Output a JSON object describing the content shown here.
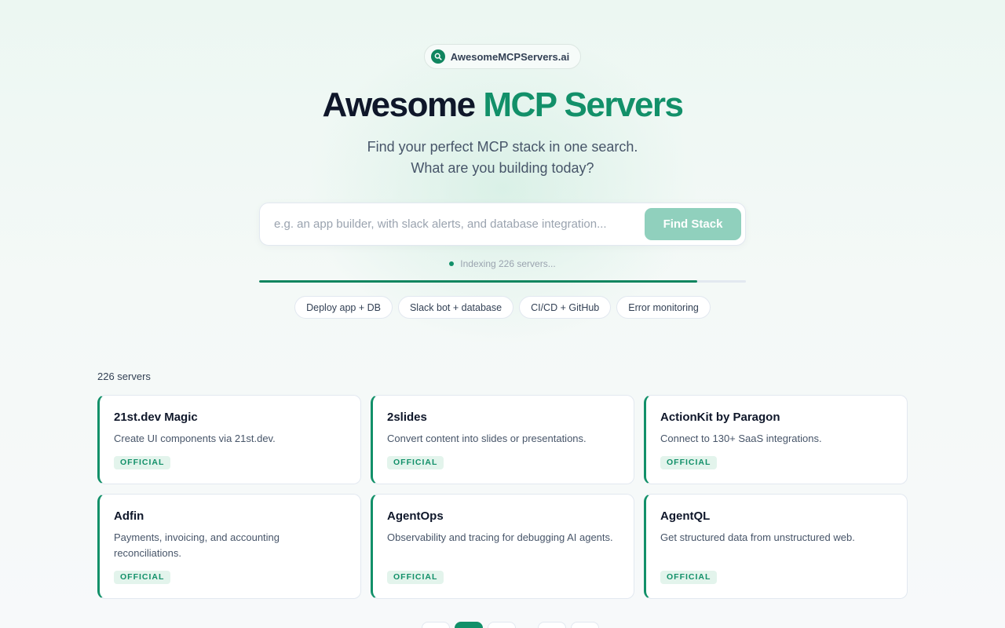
{
  "brand": {
    "label": "AwesomeMCPServers.ai"
  },
  "hero": {
    "title_part1": "Awesome",
    "title_part2": "MCP Servers",
    "subtitle_line1": "Find your perfect MCP stack in one search.",
    "subtitle_line2": "What are you building today?"
  },
  "search": {
    "placeholder": "e.g. an app builder, with slack alerts, and database integration...",
    "value": "",
    "button_label": "Find Stack"
  },
  "status": {
    "text": "Indexing 226 servers...",
    "progress": 0.9
  },
  "chips": [
    "Deploy app + DB",
    "Slack bot + database",
    "CI/CD + GitHub",
    "Error monitoring"
  ],
  "results": {
    "count": "226 servers",
    "cards": [
      {
        "name": "21st.dev Magic",
        "desc": "Create UI components via 21st.dev.",
        "badge": "OFFICIAL"
      },
      {
        "name": "2slides",
        "desc": "Convert content into slides or presentations.",
        "badge": "OFFICIAL"
      },
      {
        "name": "ActionKit by Paragon",
        "desc": "Connect to 130+ SaaS integrations.",
        "badge": "OFFICIAL"
      },
      {
        "name": "Adfin",
        "desc": "Payments, invoicing, and accounting reconciliations.",
        "badge": "OFFICIAL"
      },
      {
        "name": "AgentOps",
        "desc": "Observability and tracing for debugging AI agents.",
        "badge": "OFFICIAL"
      },
      {
        "name": "AgentQL",
        "desc": "Get structured data from unstructured web.",
        "badge": "OFFICIAL"
      }
    ]
  },
  "colors": {
    "accent": "#129069",
    "accent_dark": "#10855f",
    "button": "#90d0bd"
  }
}
